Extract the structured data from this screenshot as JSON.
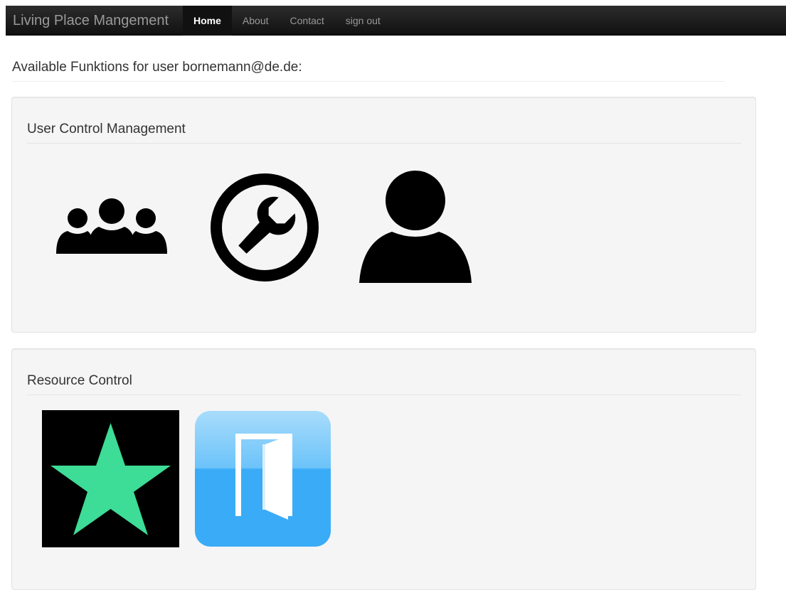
{
  "navbar": {
    "brand": "Living Place Mangement",
    "items": [
      {
        "label": "Home",
        "active": true
      },
      {
        "label": "About",
        "active": false
      },
      {
        "label": "Contact",
        "active": false
      },
      {
        "label": "sign out",
        "active": false
      }
    ]
  },
  "header": {
    "title": "Available Funktions for user bornemann@de.de:"
  },
  "sections": {
    "user_control": {
      "title": "User Control Management",
      "icons": [
        "group-icon",
        "wrench-icon",
        "user-icon"
      ]
    },
    "resource_control": {
      "title": "Resource Control",
      "icons": [
        "star-icon",
        "door-icon"
      ]
    }
  },
  "colors": {
    "star_green": "#3ddc97",
    "door_blue": "#3aabf7",
    "well_bg": "#f5f5f5"
  }
}
